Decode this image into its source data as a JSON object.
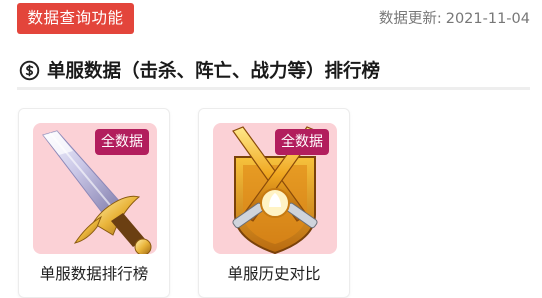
{
  "topbar": {
    "query_button": "数据查询功能",
    "update_label": "数据更新:",
    "update_date": "2021-11-04"
  },
  "section": {
    "title": "单服数据（击杀、阵亡、战力等）排行榜",
    "icon": "dollar-circle-icon"
  },
  "cards": [
    {
      "label": "单服数据排行榜",
      "badge": "全数据",
      "icon": "sword-icon"
    },
    {
      "label": "单服历史对比",
      "badge": "全数据",
      "icon": "crossed-swords-emblem-icon"
    }
  ],
  "colors": {
    "accent_red": "#e3453b",
    "badge": "#b21e5d",
    "thumb_bg": "#fbd1d6"
  }
}
